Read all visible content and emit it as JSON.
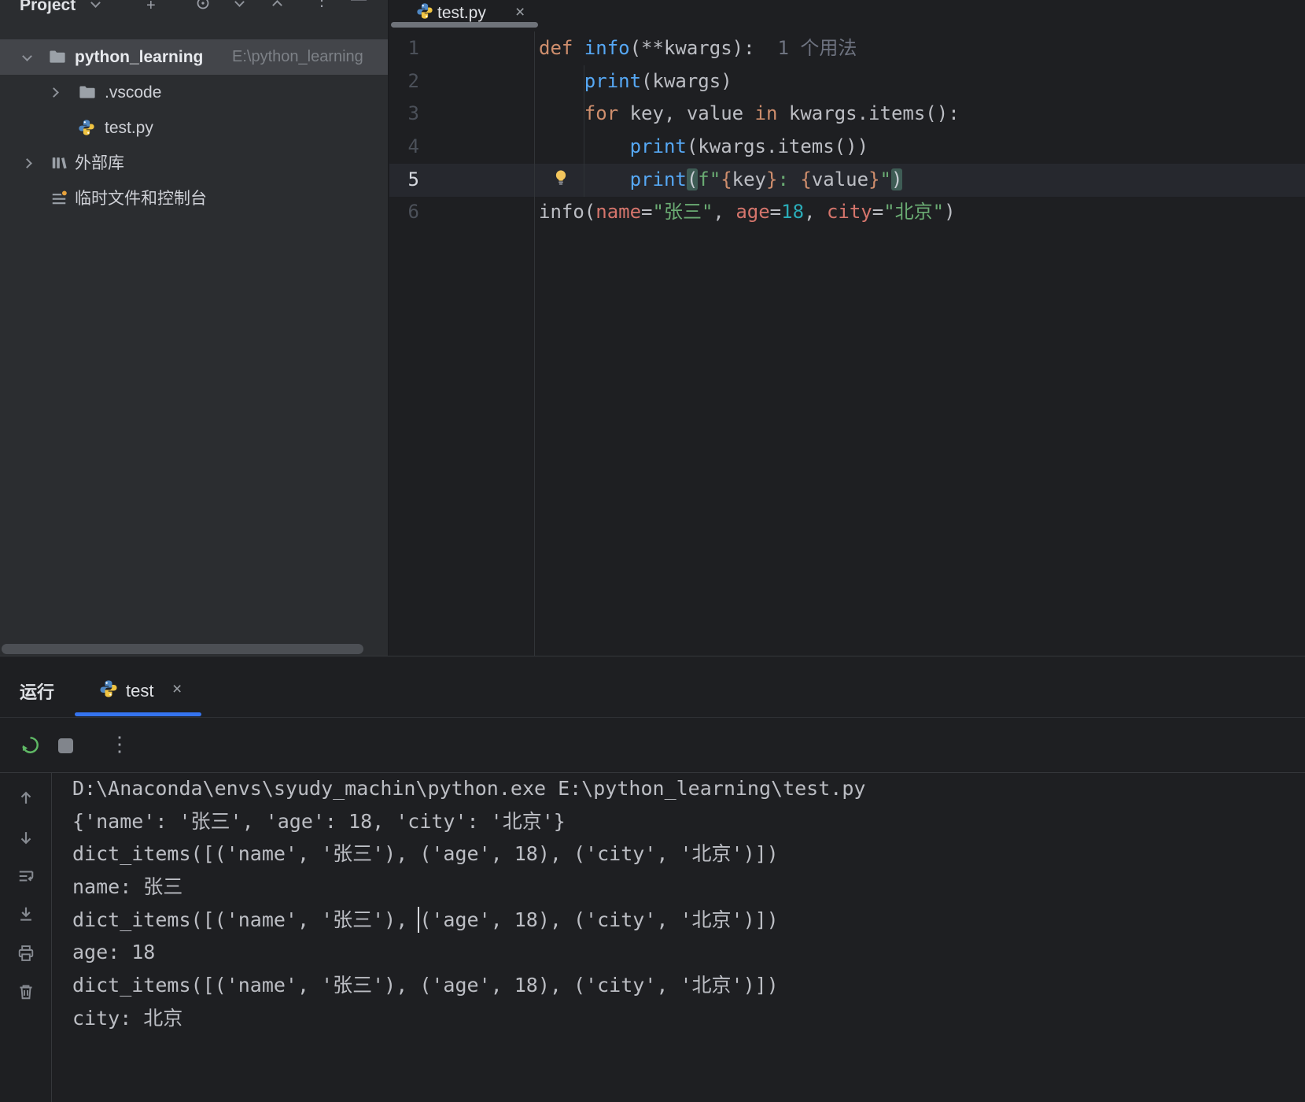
{
  "project_panel": {
    "title": "Project",
    "tree": {
      "root_name": "python_learning",
      "root_path": "E:\\python_learning",
      "vscode": ".vscode",
      "testpy": "test.py",
      "external_libs": "外部库",
      "scratches": "临时文件和控制台"
    }
  },
  "editor": {
    "tab_label": "test.py",
    "close_glyph": "×",
    "line_numbers": [
      "1",
      "2",
      "3",
      "4",
      "5",
      "6"
    ],
    "code_lines": [
      [
        {
          "t": "def ",
          "c": "kw"
        },
        {
          "t": "info",
          "c": "fn"
        },
        {
          "t": "(**kwargs):",
          "c": "txt"
        },
        {
          "t": "  1 个用法",
          "c": "hint"
        }
      ],
      [
        {
          "t": "    ",
          "c": "txt"
        },
        {
          "t": "print",
          "c": "fn"
        },
        {
          "t": "(kwargs)",
          "c": "txt"
        }
      ],
      [
        {
          "t": "    ",
          "c": "txt"
        },
        {
          "t": "for",
          "c": "kw"
        },
        {
          "t": " key, value ",
          "c": "txt"
        },
        {
          "t": "in",
          "c": "kw"
        },
        {
          "t": " kwargs.items():",
          "c": "txt"
        }
      ],
      [
        {
          "t": "        ",
          "c": "txt"
        },
        {
          "t": "print",
          "c": "fn"
        },
        {
          "t": "(kwargs.items())",
          "c": "txt"
        }
      ],
      [
        {
          "t": "        ",
          "c": "txt"
        },
        {
          "t": "print",
          "c": "fn"
        },
        {
          "t": "(",
          "c": "mp"
        },
        {
          "t": "f\"",
          "c": "str"
        },
        {
          "t": "{",
          "c": "kw"
        },
        {
          "t": "key",
          "c": "txt"
        },
        {
          "t": "}",
          "c": "kw"
        },
        {
          "t": ": ",
          "c": "str"
        },
        {
          "t": "{",
          "c": "kw"
        },
        {
          "t": "value",
          "c": "txt"
        },
        {
          "t": "}",
          "c": "kw"
        },
        {
          "t": "\"",
          "c": "str"
        },
        {
          "t": ")",
          "c": "mp"
        }
      ],
      [
        {
          "t": "info(",
          "c": "txt"
        },
        {
          "t": "name",
          "c": "param"
        },
        {
          "t": "=",
          "c": "txt"
        },
        {
          "t": "\"张三\"",
          "c": "str"
        },
        {
          "t": ", ",
          "c": "txt"
        },
        {
          "t": "age",
          "c": "param"
        },
        {
          "t": "=",
          "c": "txt"
        },
        {
          "t": "18",
          "c": "num"
        },
        {
          "t": ", ",
          "c": "txt"
        },
        {
          "t": "city",
          "c": "param"
        },
        {
          "t": "=",
          "c": "txt"
        },
        {
          "t": "\"北京\"",
          "c": "str"
        },
        {
          "t": ")",
          "c": "txt"
        }
      ]
    ]
  },
  "run_panel": {
    "panel_label": "运行",
    "tab_label": "test",
    "close_glyph": "×",
    "console_lines": [
      "D:\\Anaconda\\envs\\syudy_machin\\python.exe E:\\python_learning\\test.py",
      "{'name': '张三', 'age': 18, 'city': '北京'}",
      "dict_items([('name', '张三'), ('age', 18), ('city', '北京')])",
      "name: 张三",
      "dict_items([('name', '张三'), ('age', 18), ('city', '北京')])",
      "age: 18",
      "dict_items([('name', '张三'), ('age', 18), ('city', '北京')])",
      "city: 北京"
    ]
  },
  "colors": {
    "accent_blue": "#3574f0",
    "keyword_orange": "#cf8e6d",
    "function_blue": "#56a8f5",
    "string_green": "#6aab73",
    "number_teal": "#2aacb8",
    "named_arg_salmon": "#d5756c",
    "run_green": "#5fb865"
  }
}
